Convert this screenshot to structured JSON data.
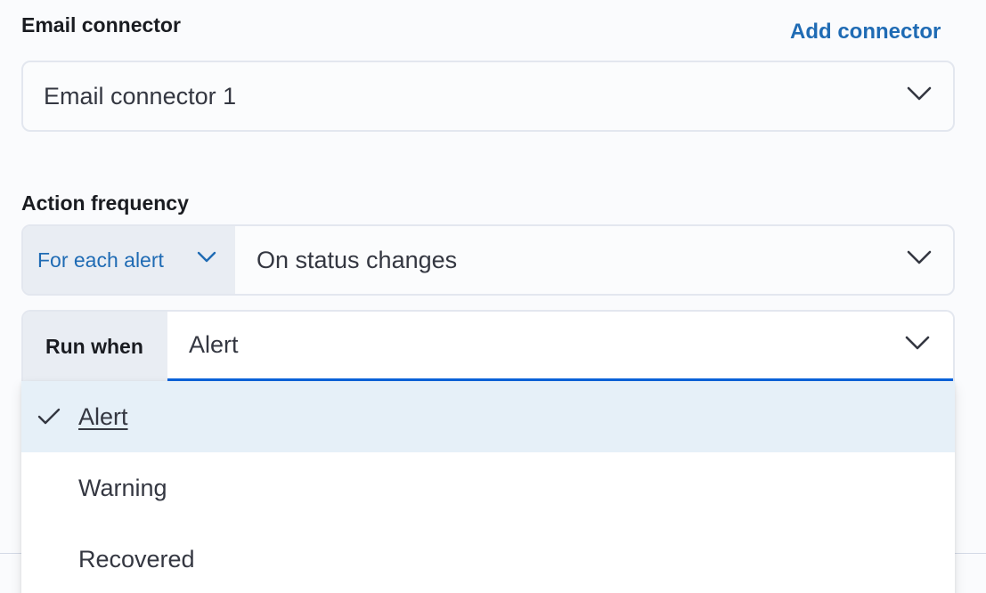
{
  "connector": {
    "label": "Email connector",
    "add_link": "Add connector",
    "selected": "Email connector 1"
  },
  "frequency": {
    "label": "Action frequency",
    "mode": "For each alert",
    "value": "On status changes"
  },
  "run_when": {
    "label": "Run when",
    "value": "Alert",
    "options": [
      {
        "label": "Alert",
        "selected": true
      },
      {
        "label": "Warning",
        "selected": false
      },
      {
        "label": "Recovered",
        "selected": false
      }
    ]
  },
  "colors": {
    "accent": "#1f6bb4",
    "focus_underline": "#0b64dd",
    "selected_option_bg": "#e6f0f8"
  },
  "icons": [
    "chevron-down-icon",
    "check-icon"
  ]
}
